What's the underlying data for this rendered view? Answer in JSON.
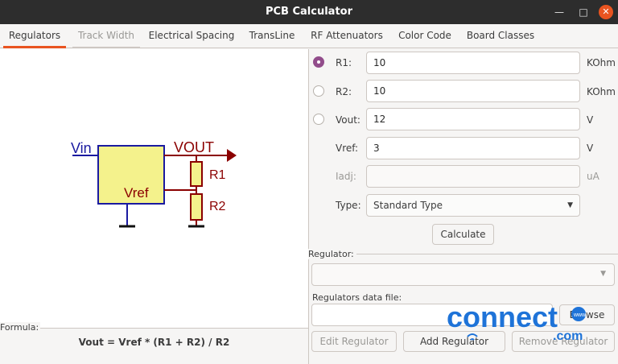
{
  "window": {
    "title": "PCB Calculator"
  },
  "tabs": [
    {
      "label": "Regulators"
    },
    {
      "label": "Track Width"
    },
    {
      "label": "Electrical Spacing"
    },
    {
      "label": "TransLine"
    },
    {
      "label": "RF Attenuators"
    },
    {
      "label": "Color Code"
    },
    {
      "label": "Board Classes"
    }
  ],
  "schematic": {
    "vin": "Vin",
    "vout": "VOUT",
    "vref": "Vref",
    "r1": "R1",
    "r2": "R2"
  },
  "formula": {
    "label": "Formula:",
    "text": "Vout = Vref * (R1 + R2) / R2"
  },
  "params": {
    "r1": {
      "label": "R1:",
      "value": "10",
      "unit": "KOhm"
    },
    "r2": {
      "label": "R2:",
      "value": "10",
      "unit": "KOhm"
    },
    "vout": {
      "label": "Vout:",
      "value": "12",
      "unit": "V"
    },
    "vref": {
      "label": "Vref:",
      "value": "3",
      "unit": "V"
    },
    "iadj": {
      "label": "Iadj:",
      "value": "",
      "unit": "uA"
    },
    "type": {
      "label": "Type:",
      "value": "Standard Type"
    }
  },
  "buttons": {
    "calculate": "Calculate",
    "browse": "Browse",
    "edit_regulator": "Edit Regulator",
    "add_regulator": "Add Regulator",
    "remove_regulator": "Remove Regulator"
  },
  "regulator_group": {
    "label": "Regulator:",
    "data_file_label": "Regulators data file:"
  },
  "watermark": {
    "text": "connect",
    "domain": ".com",
    "www": "www"
  },
  "colors": {
    "accent": "#e95420",
    "radio_checked": "#924d8b",
    "schematic_blue": "#1a1aa0",
    "schematic_dark_red": "#8b0000",
    "regulator_fill": "#f4f28c",
    "resistor_fill": "#f4f28c",
    "watermark_blue": "#1e73d8"
  }
}
